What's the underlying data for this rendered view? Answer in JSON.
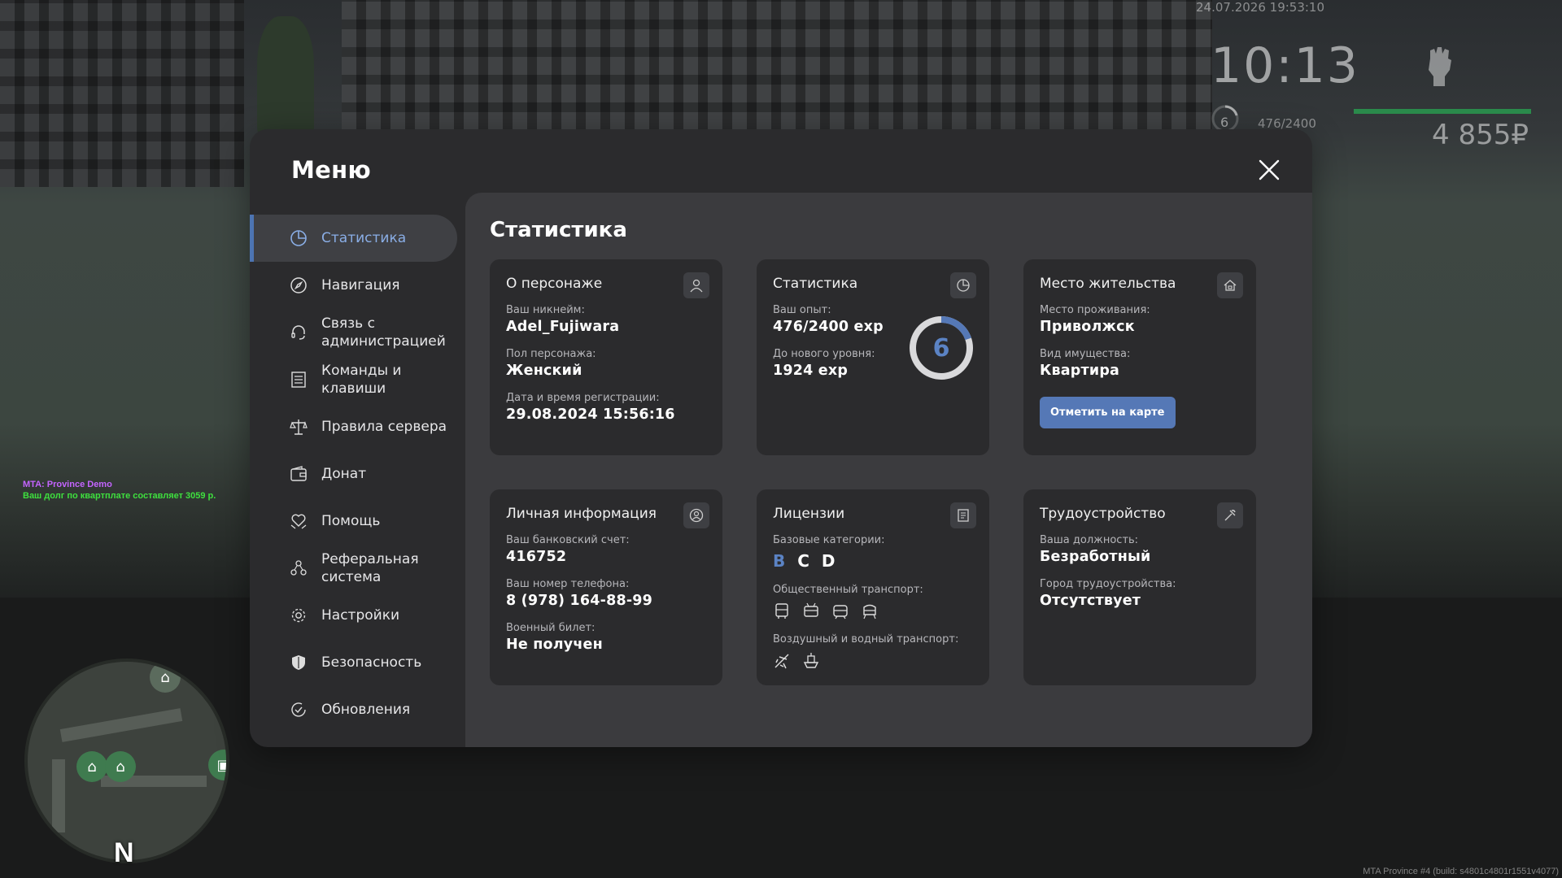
{
  "hud": {
    "datetime": "24.07.2026 19:53:10",
    "clock": "10:13",
    "level": "6",
    "exp": "476/2400",
    "money": "4 855₽",
    "chat_title": "MTA: Province Demo",
    "chat_message": "Ваш долг по квартплате составляет 3059 р.",
    "build": "MTA Province #4 (build: s4801c4801r1551v4077)",
    "minimap_north": "N"
  },
  "menu": {
    "title": "Меню",
    "close_icon": "close-icon",
    "sidebar": [
      {
        "label": "Статистика",
        "icon": "chart-pie-icon",
        "active": true
      },
      {
        "label": "Навигация",
        "icon": "compass-icon",
        "active": false
      },
      {
        "label": "Связь с\nадминистрацией",
        "icon": "headset-icon",
        "active": false
      },
      {
        "label": "Команды и\nклавиши",
        "icon": "list-icon",
        "active": false
      },
      {
        "label": "Правила сервера",
        "icon": "scales-icon",
        "active": false
      },
      {
        "label": "Донат",
        "icon": "wallet-icon",
        "active": false
      },
      {
        "label": "Помощь",
        "icon": "heart-hand-icon",
        "active": false
      },
      {
        "label": "Реферальная\nсистема",
        "icon": "people-icon",
        "active": false
      },
      {
        "label": "Настройки",
        "icon": "gear-icon",
        "active": false
      },
      {
        "label": "Безопасность",
        "icon": "shield-icon",
        "active": false
      },
      {
        "label": "Обновления",
        "icon": "refresh-check-icon",
        "active": false
      }
    ]
  },
  "content": {
    "title": "Статистика",
    "character": {
      "title": "О персонаже",
      "nick_label": "Ваш никнейм:",
      "nick": "Adel_Fujiwara",
      "gender_label": "Пол персонажа:",
      "gender": "Женский",
      "reg_label": "Дата и время регистрации:",
      "reg": "29.08.2024 15:56:16"
    },
    "stats": {
      "title": "Статистика",
      "exp_label": "Ваш опыт:",
      "exp": "476/2400 exp",
      "next_label": "До нового уровня:",
      "next": "1924 exp",
      "level": "6",
      "progress": 0.198
    },
    "residence": {
      "title": "Место жительства",
      "place_label": "Место проживания:",
      "place": "Приволжск",
      "type_label": "Вид имущества:",
      "type": "Квартира",
      "button": "Отметить на карте"
    },
    "personal": {
      "title": "Личная информация",
      "bank_label": "Ваш банковский счет:",
      "bank": "416752",
      "phone_label": "Ваш номер телефона:",
      "phone": "8 (978) 164-88-99",
      "military_label": "Военный билет:",
      "military": "Не получен"
    },
    "licenses": {
      "title": "Лицензии",
      "base_label": "Базовые категории:",
      "categories": [
        "B",
        "C",
        "D"
      ],
      "public_label": "Общественный транспорт:",
      "air_label": "Воздушный и водный транспорт:"
    },
    "job": {
      "title": "Трудоустройство",
      "position_label": "Ваша должность:",
      "position": "Безработный",
      "city_label": "Город трудоустройства:",
      "city": "Отсутствует"
    }
  },
  "colors": {
    "accent": "#5578b6",
    "panel": "#2b2b2d",
    "content": "#3b3b3e",
    "card": "#2b2b2d"
  }
}
